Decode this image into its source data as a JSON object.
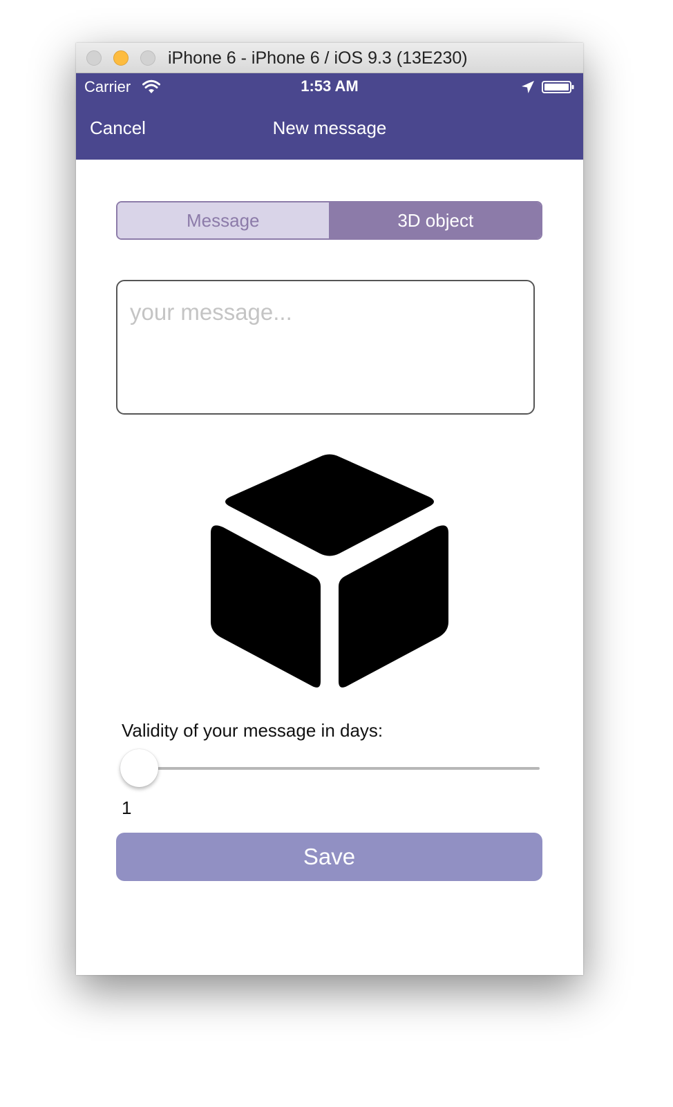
{
  "window": {
    "title": "iPhone 6 - iPhone 6 / iOS 9.3 (13E230)"
  },
  "status_bar": {
    "carrier": "Carrier",
    "time": "1:53 AM",
    "icons": [
      "wifi-icon",
      "location-arrow-icon",
      "battery-icon"
    ]
  },
  "nav_bar": {
    "cancel_label": "Cancel",
    "title": "New message"
  },
  "segmented_control": {
    "options": [
      "Message",
      "3D object"
    ],
    "selected": "3D object"
  },
  "message_input": {
    "value": "",
    "placeholder": "your message..."
  },
  "content_icon": "cube-icon",
  "validity": {
    "label": "Validity of your message in days:",
    "value": "1",
    "slider_fraction": 0
  },
  "save_label": "Save",
  "colors": {
    "nav_background": "#4a478e",
    "segment_active": "#8c7ba9",
    "segment_inactive": "#d9d4e8",
    "save_button": "#9190c3"
  }
}
